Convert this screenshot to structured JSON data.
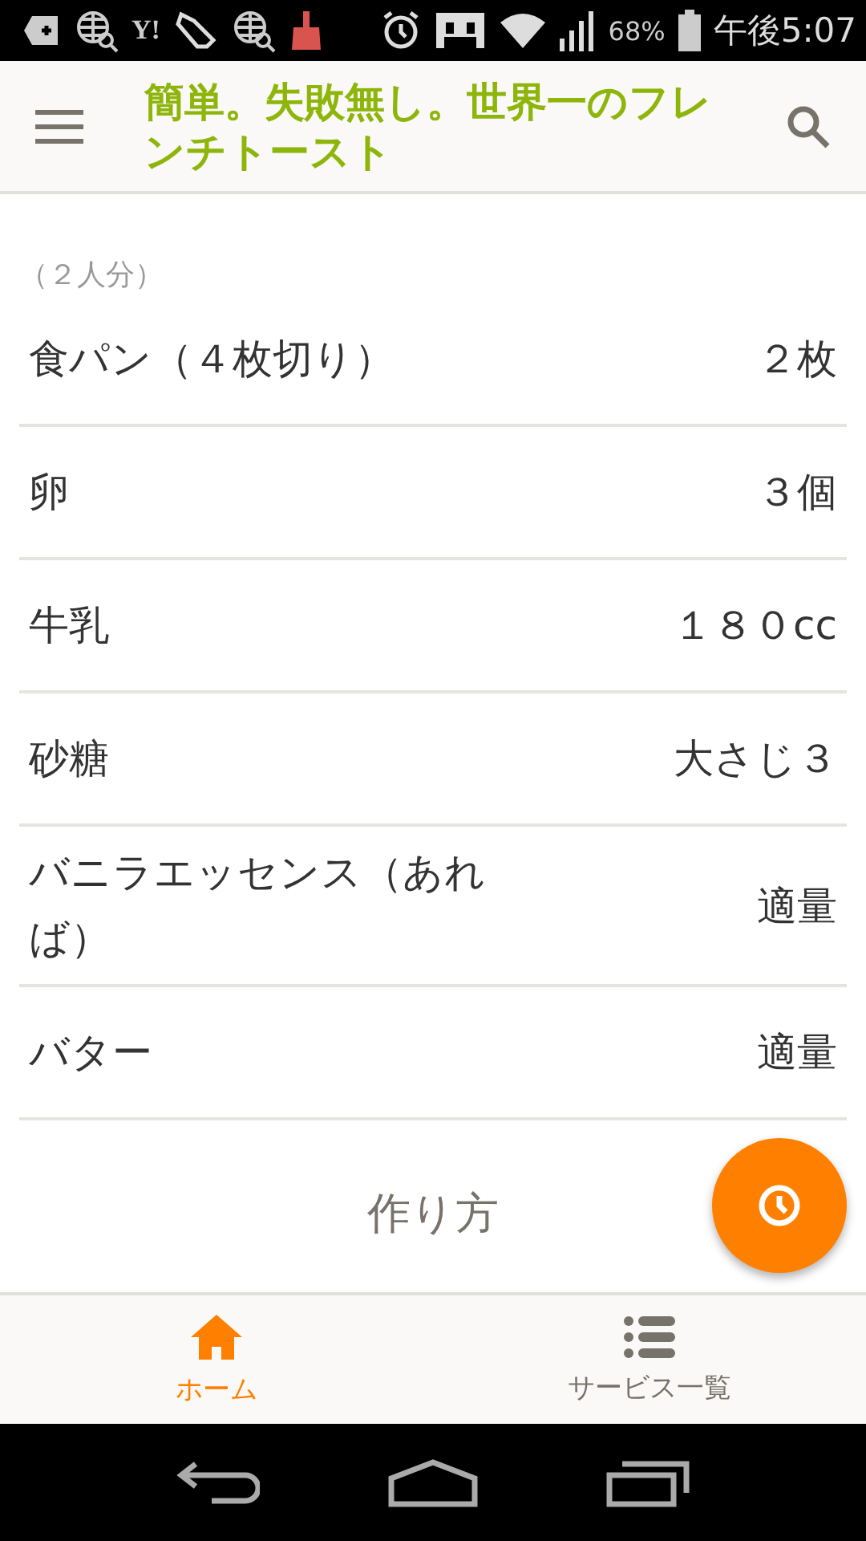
{
  "status_bar": {
    "app_mark": "Y!",
    "battery": "68%",
    "time": "午後5:07"
  },
  "header": {
    "title": "簡単。失敗無し。世界一のフレンチトースト"
  },
  "ingredients": {
    "servings": "（２人分）",
    "rows": [
      {
        "name": "食パン（４枚切り）",
        "amount": "２枚"
      },
      {
        "name": "卵",
        "amount": "３個"
      },
      {
        "name": "牛乳",
        "amount": "１８０cc"
      },
      {
        "name": "砂糖",
        "amount": "大さじ３"
      },
      {
        "name": "バニラエッセンス（あれば）",
        "amount": "適量"
      },
      {
        "name": "バター",
        "amount": "適量"
      }
    ]
  },
  "steps": {
    "heading": "作り方"
  },
  "bottom_nav": [
    {
      "kind": "home",
      "label": "ホーム",
      "selected": true
    },
    {
      "kind": "list",
      "label": "サービス一覧",
      "selected": false
    }
  ]
}
